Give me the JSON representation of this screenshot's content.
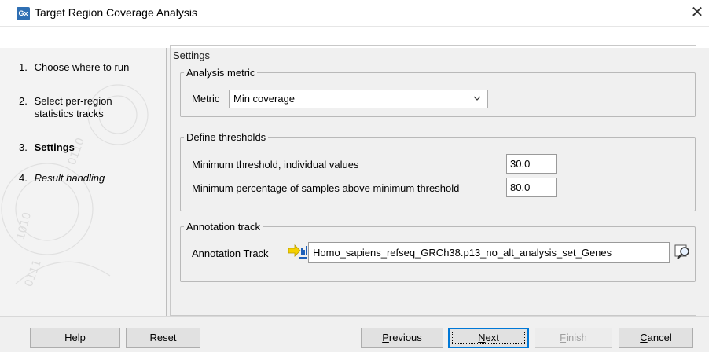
{
  "window": {
    "app_icon_text": "Gx",
    "title": "Target Region Coverage Analysis",
    "close_glyph": "✕"
  },
  "sidebar": {
    "steps": [
      {
        "num": "1.",
        "label": "Choose where to run",
        "state": "done"
      },
      {
        "num": "2.",
        "label": "Select per-region statistics tracks",
        "state": "done"
      },
      {
        "num": "3.",
        "label": "Settings",
        "state": "active"
      },
      {
        "num": "4.",
        "label": "Result handling",
        "state": "pending"
      }
    ]
  },
  "settings": {
    "title": "Settings",
    "analysis_metric": {
      "legend": "Analysis metric",
      "metric_label": "Metric",
      "metric_value": "Min coverage"
    },
    "thresholds": {
      "legend": "Define thresholds",
      "min_threshold_label": "Minimum threshold, individual values",
      "min_threshold_value": "30.0",
      "min_percentage_label": "Minimum percentage of samples above minimum threshold",
      "min_percentage_value": "80.0"
    },
    "annotation": {
      "legend": "Annotation track",
      "track_label": "Annotation Track",
      "track_value": "Homo_sapiens_refseq_GRCh38.p13_no_alt_analysis_set_Genes",
      "track_icon": "gene-track-icon",
      "browse_icon": "browse-magnifier-icon"
    }
  },
  "buttons": {
    "help": "Help",
    "reset": "Reset",
    "previous_underlined": "P",
    "previous_rest": "revious",
    "next_underlined": "N",
    "next_rest": "ext",
    "finish_underlined": "F",
    "finish_rest": "inish",
    "cancel_underlined": "C",
    "cancel_rest": "ancel"
  },
  "colors": {
    "accent": "#0078d7",
    "app_icon_bg": "#2f6fb3",
    "track_icon_yellow": "#f4d000",
    "track_icon_blue": "#1e5fb8"
  }
}
